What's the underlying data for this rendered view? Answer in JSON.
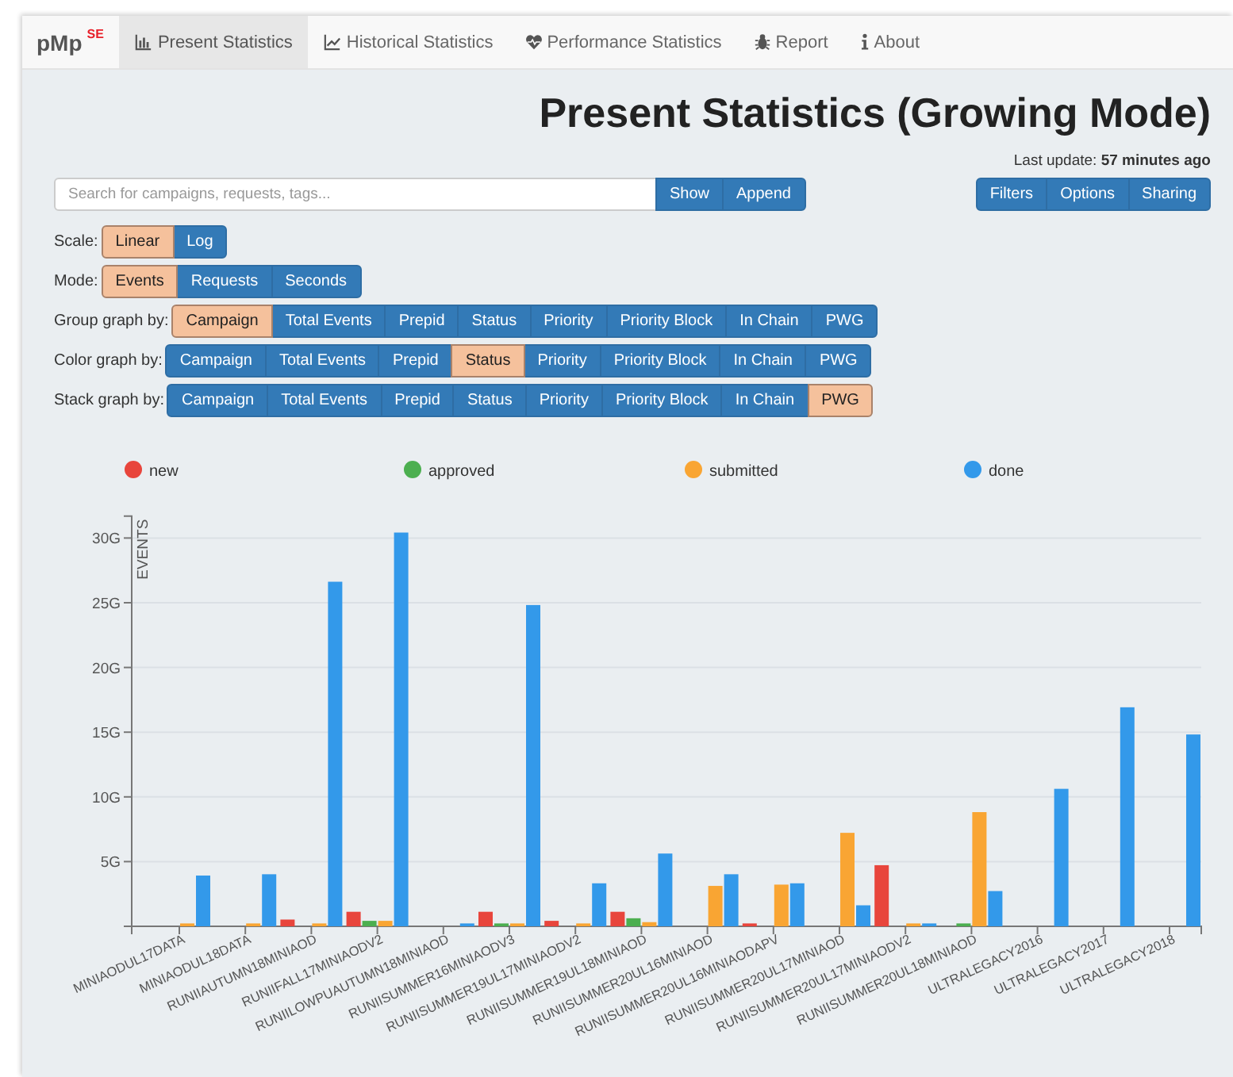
{
  "navbar": {
    "brand": "pMp",
    "brand_badge": "SE",
    "tabs": [
      {
        "label": "Present Statistics",
        "selected": true
      },
      {
        "label": "Historical Statistics",
        "selected": false
      },
      {
        "label": "Performance Statistics",
        "selected": false
      },
      {
        "label": "Report",
        "selected": false
      },
      {
        "label": "About",
        "selected": false
      }
    ]
  },
  "page_title": "Present Statistics (Growing Mode)",
  "last_update": "Last update: **57 minutes ago**",
  "search": {
    "placeholder": "Search for campaigns, requests, tags...",
    "buttons": [
      "Show",
      "Append"
    ]
  },
  "tool_buttons": [
    "Filters",
    "Options",
    "Sharing"
  ],
  "option_rows": [
    {
      "label": "Scale:",
      "options": [
        {
          "label": "Linear",
          "selected": true
        },
        {
          "label": "Log",
          "selected": false
        }
      ]
    },
    {
      "label": "Mode:",
      "options": [
        {
          "label": "Events",
          "selected": true
        },
        {
          "label": "Requests",
          "selected": false
        },
        {
          "label": "Seconds",
          "selected": false
        }
      ]
    },
    {
      "label": "Group graph by:",
      "options": [
        {
          "label": "Campaign",
          "selected": true
        },
        {
          "label": "Total Events",
          "selected": false
        },
        {
          "label": "Prepid",
          "selected": false
        },
        {
          "label": "Status",
          "selected": false
        },
        {
          "label": "Priority",
          "selected": false
        },
        {
          "label": "Priority Block",
          "selected": false
        },
        {
          "label": "In Chain",
          "selected": false
        },
        {
          "label": "PWG",
          "selected": false
        }
      ]
    },
    {
      "label": "Color graph by:",
      "options": [
        {
          "label": "Campaign",
          "selected": false
        },
        {
          "label": "Total Events",
          "selected": false
        },
        {
          "label": "Prepid",
          "selected": false
        },
        {
          "label": "Status",
          "selected": true
        },
        {
          "label": "Priority",
          "selected": false
        },
        {
          "label": "Priority Block",
          "selected": false
        },
        {
          "label": "In Chain",
          "selected": false
        },
        {
          "label": "PWG",
          "selected": false
        }
      ]
    },
    {
      "label": "Stack graph by:",
      "options": [
        {
          "label": "Campaign",
          "selected": false
        },
        {
          "label": "Total Events",
          "selected": false
        },
        {
          "label": "Prepid",
          "selected": false
        },
        {
          "label": "Status",
          "selected": false
        },
        {
          "label": "Priority",
          "selected": false
        },
        {
          "label": "Priority Block",
          "selected": false
        },
        {
          "label": "In Chain",
          "selected": false
        },
        {
          "label": "PWG",
          "selected": true
        }
      ]
    }
  ],
  "chart": {
    "chart_data": {
      "type": "bar",
      "ylabel": "EVENTS",
      "ylim": [
        0,
        31.7
      ],
      "grid": true,
      "legend": "top",
      "yticks": [
        {
          "value": 5,
          "label": "5G"
        },
        {
          "value": 10,
          "label": "10G"
        },
        {
          "value": 15,
          "label": "15G"
        },
        {
          "value": 20,
          "label": "20G"
        },
        {
          "value": 25,
          "label": "25G"
        },
        {
          "value": 30,
          "label": "30G"
        }
      ],
      "categories": [
        "MINIAODUL17DATA",
        "MINIAODUL18DATA",
        "RUNIIAUTUMN18MINIAOD",
        "RUNIIFALL17MINIAODV2",
        "RUNIILOWPUAUTUMN18MINIAOD",
        "RUNIISUMMER16MINIAODV3",
        "RUNIISUMMER19UL17MINIAODV2",
        "RUNIISUMMER19UL18MINIAOD",
        "RUNIISUMMER20UL16MINIAOD",
        "RUNIISUMMER20UL16MINIAODAPV",
        "RUNIISUMMER20UL17MINIAOD",
        "RUNIISUMMER20UL17MINIAODV2",
        "RUNIISUMMER20UL18MINIAOD",
        "ULTRALEGACY2016",
        "ULTRALEGACY2017",
        "ULTRALEGACY2018"
      ],
      "series": [
        {
          "name": "new",
          "color": "#e8453c",
          "values": [
            0,
            0,
            0.4,
            1.0,
            0,
            1.0,
            0.3,
            1.0,
            0,
            0.1,
            0,
            4.6,
            0,
            0,
            0,
            0
          ]
        },
        {
          "name": "approved",
          "color": "#4caf50",
          "values": [
            0,
            0,
            0,
            0.3,
            0,
            0.1,
            0,
            0.5,
            0,
            0,
            0,
            0,
            0.1,
            0,
            0,
            0
          ]
        },
        {
          "name": "submitted",
          "color": "#f9a533",
          "values": [
            0.1,
            0.1,
            0.1,
            0.3,
            0,
            0.1,
            0.1,
            0.2,
            3.0,
            3.1,
            7.1,
            0.1,
            8.7,
            0,
            0,
            0
          ]
        },
        {
          "name": "done",
          "color": "#3399ea",
          "values": [
            3.8,
            3.9,
            26.5,
            30.3,
            0.1,
            24.7,
            3.2,
            5.5,
            3.9,
            3.2,
            1.5,
            0.1,
            2.6,
            10.5,
            16.8,
            14.7
          ]
        }
      ]
    }
  }
}
